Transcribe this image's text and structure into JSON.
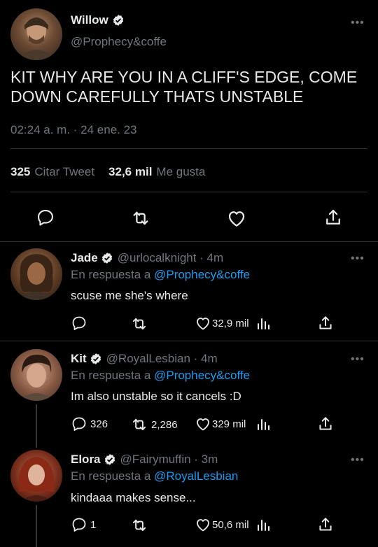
{
  "main_tweet": {
    "author_name": "Willow",
    "handle": "@Prophecy&coffe",
    "text": "KIT WHY ARE YOU IN A CLIFF'S EDGE, COME DOWN CAREFULLY THATS UNSTABLE",
    "timestamp": "02:24 a. m. · 24 ene. 23",
    "stats": {
      "quotes_count": "325",
      "quotes_label": "Citar Tweet",
      "likes_count": "32,6 mil",
      "likes_label": "Me gusta"
    }
  },
  "replies": [
    {
      "author_name": "Jade",
      "handle_time": "@urlocalknight · 4m",
      "reply_to_prefix": "En respuesta a",
      "reply_to_handle": "@Prophecy&coffe",
      "text": "scuse me she's where",
      "reply_count": "",
      "retweet_count": "",
      "like_count": "32,9 mil"
    },
    {
      "author_name": "Kit",
      "handle_time": "@RoyalLesbian · 4m",
      "reply_to_prefix": "En respuesta a",
      "reply_to_handle": "@Prophecy&coffe",
      "text": "Im also unstable so it cancels :D",
      "reply_count": "326",
      "retweet_count": "2,286",
      "like_count": "329 mil"
    },
    {
      "author_name": "Elora",
      "handle_time": "@Fairymuffin · 3m",
      "reply_to_prefix": "En respuesta a",
      "reply_to_handle": "@RoyalLesbian",
      "text": "kindaaa makes sense...",
      "reply_count": "1",
      "retweet_count": "",
      "like_count": "50,6 mil"
    }
  ],
  "icons": {
    "more": "more-icon",
    "verified": "verified-badge-icon",
    "reply": "reply-icon",
    "retweet": "retweet-icon",
    "like": "like-icon",
    "share": "share-icon",
    "analytics": "analytics-icon"
  },
  "colors": {
    "background": "#000000",
    "text": "#e7e9ea",
    "muted": "#71767b",
    "accent": "#1d9bf0",
    "divider": "#2f3336"
  }
}
